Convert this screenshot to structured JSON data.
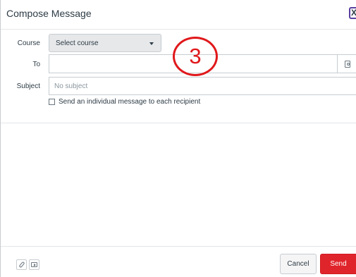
{
  "dialog": {
    "title": "Compose Message",
    "close_label": "X"
  },
  "form": {
    "course_label": "Course",
    "course_value": "Select course",
    "to_label": "To",
    "to_value": "",
    "subject_label": "Subject",
    "subject_placeholder": "No subject",
    "individual_label": "Send an individual message to each recipient",
    "individual_checked": false
  },
  "annotation": {
    "number": "3",
    "color": "#e0181b"
  },
  "footer": {
    "cancel_label": "Cancel",
    "send_label": "Send",
    "send_color": "#e0242b"
  },
  "icons": [
    "close-icon",
    "address-book-icon",
    "caret-down-icon",
    "paperclip-icon",
    "media-icon"
  ]
}
